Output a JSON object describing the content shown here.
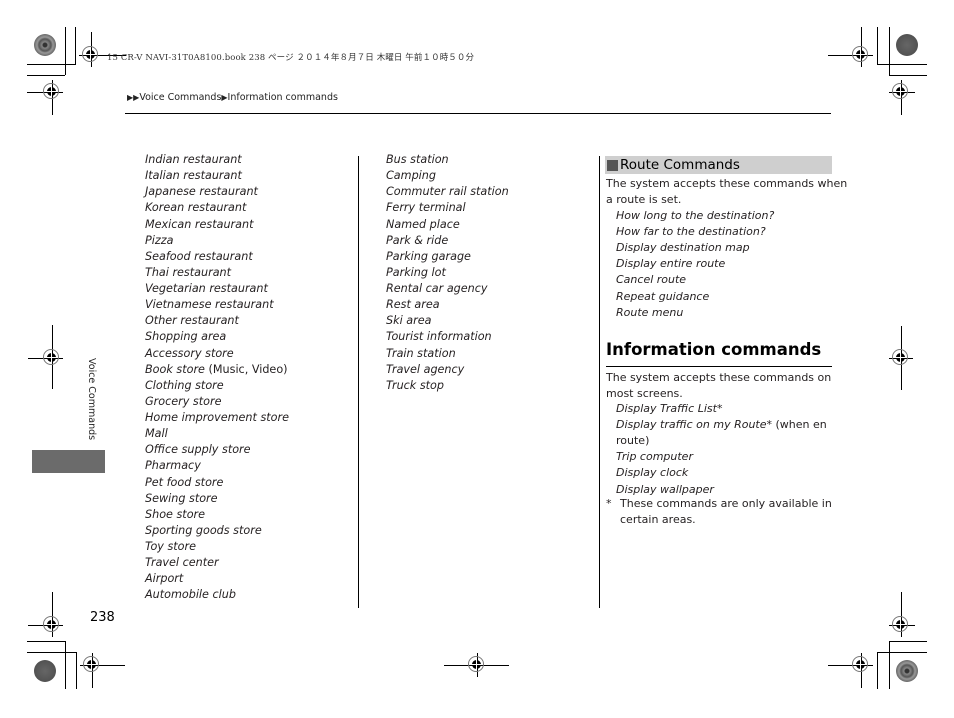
{
  "print_header": {
    "file_info": "15 CR-V NAVI-31T0A8100.book  238 ページ  ２０１４年８月７日  木曜日  午前１０時５０分"
  },
  "breadcrumb": {
    "arrow_icon": "double-triangle-right",
    "items": [
      "Voice Commands",
      "Information commands"
    ]
  },
  "side_tab": {
    "label": "Voice Commands",
    "color": "#6b6b6b"
  },
  "column1": {
    "items": [
      {
        "text": "Indian restaurant"
      },
      {
        "text": "Italian restaurant"
      },
      {
        "text": "Japanese restaurant"
      },
      {
        "text": "Korean restaurant"
      },
      {
        "text": "Mexican restaurant"
      },
      {
        "text": "Pizza"
      },
      {
        "text": "Seafood restaurant"
      },
      {
        "text": "Thai restaurant"
      },
      {
        "text": "Vegetarian restaurant"
      },
      {
        "text": "Vietnamese restaurant"
      },
      {
        "text": "Other restaurant"
      },
      {
        "text": "Shopping area"
      },
      {
        "text": "Accessory store"
      },
      {
        "text": "Book store",
        "suffix": " (Music, Video)"
      },
      {
        "text": "Clothing store"
      },
      {
        "text": "Grocery store"
      },
      {
        "text": "Home improvement store"
      },
      {
        "text": "Mall"
      },
      {
        "text": "Office supply store"
      },
      {
        "text": "Pharmacy"
      },
      {
        "text": "Pet food store"
      },
      {
        "text": "Sewing store"
      },
      {
        "text": "Shoe store"
      },
      {
        "text": "Sporting goods store"
      },
      {
        "text": "Toy store"
      },
      {
        "text": "Travel center"
      },
      {
        "text": "Airport"
      },
      {
        "text": "Automobile club"
      }
    ]
  },
  "column2": {
    "items": [
      {
        "text": "Bus station"
      },
      {
        "text": "Camping"
      },
      {
        "text": "Commuter rail station"
      },
      {
        "text": "Ferry terminal"
      },
      {
        "text": "Named place"
      },
      {
        "text": "Park & ride"
      },
      {
        "text": "Parking garage"
      },
      {
        "text": "Parking lot"
      },
      {
        "text": "Rental car agency"
      },
      {
        "text": "Rest area"
      },
      {
        "text": "Ski area"
      },
      {
        "text": "Tourist information"
      },
      {
        "text": "Train station"
      },
      {
        "text": "Travel agency"
      },
      {
        "text": "Truck stop"
      }
    ]
  },
  "route_commands": {
    "title": "Route Commands",
    "intro_line1": "The system accepts these commands when",
    "intro_line2": "a route is set.",
    "items": [
      "How long to the destination?",
      "How far to the destination?",
      "Display destination map",
      "Display entire route",
      "Cancel route",
      "Repeat guidance",
      "Route menu"
    ]
  },
  "information_commands": {
    "title": "Information commands",
    "intro_line1": "The system accepts these commands on",
    "intro_line2": "most screens.",
    "items": [
      {
        "text": "Display Traffic List*"
      },
      {
        "text": "Display traffic on my Route*",
        "suffix": " (when en"
      },
      {
        "text": "",
        "suffix": "route)"
      },
      {
        "text": "Trip computer"
      },
      {
        "text": "Display clock"
      },
      {
        "text": "Display wallpaper"
      }
    ],
    "footnote_mark": "*",
    "footnote_line1": "These commands are only available in",
    "footnote_line2": "certain areas."
  },
  "page_number": "238"
}
